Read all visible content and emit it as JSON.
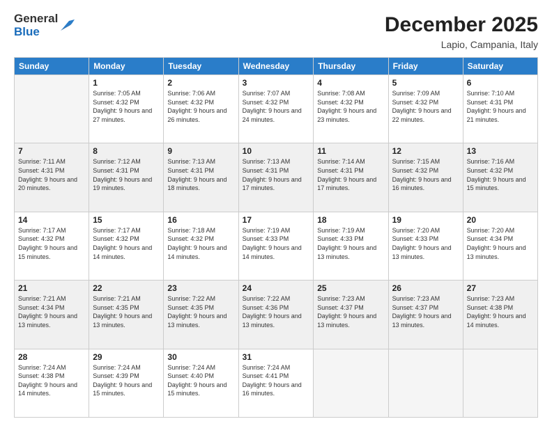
{
  "header": {
    "logo_general": "General",
    "logo_blue": "Blue",
    "month": "December 2025",
    "location": "Lapio, Campania, Italy"
  },
  "days_of_week": [
    "Sunday",
    "Monday",
    "Tuesday",
    "Wednesday",
    "Thursday",
    "Friday",
    "Saturday"
  ],
  "weeks": [
    [
      {
        "day": "",
        "sunrise": "",
        "sunset": "",
        "daylight": ""
      },
      {
        "day": "1",
        "sunrise": "Sunrise: 7:05 AM",
        "sunset": "Sunset: 4:32 PM",
        "daylight": "Daylight: 9 hours and 27 minutes."
      },
      {
        "day": "2",
        "sunrise": "Sunrise: 7:06 AM",
        "sunset": "Sunset: 4:32 PM",
        "daylight": "Daylight: 9 hours and 26 minutes."
      },
      {
        "day": "3",
        "sunrise": "Sunrise: 7:07 AM",
        "sunset": "Sunset: 4:32 PM",
        "daylight": "Daylight: 9 hours and 24 minutes."
      },
      {
        "day": "4",
        "sunrise": "Sunrise: 7:08 AM",
        "sunset": "Sunset: 4:32 PM",
        "daylight": "Daylight: 9 hours and 23 minutes."
      },
      {
        "day": "5",
        "sunrise": "Sunrise: 7:09 AM",
        "sunset": "Sunset: 4:32 PM",
        "daylight": "Daylight: 9 hours and 22 minutes."
      },
      {
        "day": "6",
        "sunrise": "Sunrise: 7:10 AM",
        "sunset": "Sunset: 4:31 PM",
        "daylight": "Daylight: 9 hours and 21 minutes."
      }
    ],
    [
      {
        "day": "7",
        "sunrise": "Sunrise: 7:11 AM",
        "sunset": "Sunset: 4:31 PM",
        "daylight": "Daylight: 9 hours and 20 minutes."
      },
      {
        "day": "8",
        "sunrise": "Sunrise: 7:12 AM",
        "sunset": "Sunset: 4:31 PM",
        "daylight": "Daylight: 9 hours and 19 minutes."
      },
      {
        "day": "9",
        "sunrise": "Sunrise: 7:13 AM",
        "sunset": "Sunset: 4:31 PM",
        "daylight": "Daylight: 9 hours and 18 minutes."
      },
      {
        "day": "10",
        "sunrise": "Sunrise: 7:13 AM",
        "sunset": "Sunset: 4:31 PM",
        "daylight": "Daylight: 9 hours and 17 minutes."
      },
      {
        "day": "11",
        "sunrise": "Sunrise: 7:14 AM",
        "sunset": "Sunset: 4:31 PM",
        "daylight": "Daylight: 9 hours and 17 minutes."
      },
      {
        "day": "12",
        "sunrise": "Sunrise: 7:15 AM",
        "sunset": "Sunset: 4:32 PM",
        "daylight": "Daylight: 9 hours and 16 minutes."
      },
      {
        "day": "13",
        "sunrise": "Sunrise: 7:16 AM",
        "sunset": "Sunset: 4:32 PM",
        "daylight": "Daylight: 9 hours and 15 minutes."
      }
    ],
    [
      {
        "day": "14",
        "sunrise": "Sunrise: 7:17 AM",
        "sunset": "Sunset: 4:32 PM",
        "daylight": "Daylight: 9 hours and 15 minutes."
      },
      {
        "day": "15",
        "sunrise": "Sunrise: 7:17 AM",
        "sunset": "Sunset: 4:32 PM",
        "daylight": "Daylight: 9 hours and 14 minutes."
      },
      {
        "day": "16",
        "sunrise": "Sunrise: 7:18 AM",
        "sunset": "Sunset: 4:32 PM",
        "daylight": "Daylight: 9 hours and 14 minutes."
      },
      {
        "day": "17",
        "sunrise": "Sunrise: 7:19 AM",
        "sunset": "Sunset: 4:33 PM",
        "daylight": "Daylight: 9 hours and 14 minutes."
      },
      {
        "day": "18",
        "sunrise": "Sunrise: 7:19 AM",
        "sunset": "Sunset: 4:33 PM",
        "daylight": "Daylight: 9 hours and 13 minutes."
      },
      {
        "day": "19",
        "sunrise": "Sunrise: 7:20 AM",
        "sunset": "Sunset: 4:33 PM",
        "daylight": "Daylight: 9 hours and 13 minutes."
      },
      {
        "day": "20",
        "sunrise": "Sunrise: 7:20 AM",
        "sunset": "Sunset: 4:34 PM",
        "daylight": "Daylight: 9 hours and 13 minutes."
      }
    ],
    [
      {
        "day": "21",
        "sunrise": "Sunrise: 7:21 AM",
        "sunset": "Sunset: 4:34 PM",
        "daylight": "Daylight: 9 hours and 13 minutes."
      },
      {
        "day": "22",
        "sunrise": "Sunrise: 7:21 AM",
        "sunset": "Sunset: 4:35 PM",
        "daylight": "Daylight: 9 hours and 13 minutes."
      },
      {
        "day": "23",
        "sunrise": "Sunrise: 7:22 AM",
        "sunset": "Sunset: 4:35 PM",
        "daylight": "Daylight: 9 hours and 13 minutes."
      },
      {
        "day": "24",
        "sunrise": "Sunrise: 7:22 AM",
        "sunset": "Sunset: 4:36 PM",
        "daylight": "Daylight: 9 hours and 13 minutes."
      },
      {
        "day": "25",
        "sunrise": "Sunrise: 7:23 AM",
        "sunset": "Sunset: 4:37 PM",
        "daylight": "Daylight: 9 hours and 13 minutes."
      },
      {
        "day": "26",
        "sunrise": "Sunrise: 7:23 AM",
        "sunset": "Sunset: 4:37 PM",
        "daylight": "Daylight: 9 hours and 13 minutes."
      },
      {
        "day": "27",
        "sunrise": "Sunrise: 7:23 AM",
        "sunset": "Sunset: 4:38 PM",
        "daylight": "Daylight: 9 hours and 14 minutes."
      }
    ],
    [
      {
        "day": "28",
        "sunrise": "Sunrise: 7:24 AM",
        "sunset": "Sunset: 4:38 PM",
        "daylight": "Daylight: 9 hours and 14 minutes."
      },
      {
        "day": "29",
        "sunrise": "Sunrise: 7:24 AM",
        "sunset": "Sunset: 4:39 PM",
        "daylight": "Daylight: 9 hours and 15 minutes."
      },
      {
        "day": "30",
        "sunrise": "Sunrise: 7:24 AM",
        "sunset": "Sunset: 4:40 PM",
        "daylight": "Daylight: 9 hours and 15 minutes."
      },
      {
        "day": "31",
        "sunrise": "Sunrise: 7:24 AM",
        "sunset": "Sunset: 4:41 PM",
        "daylight": "Daylight: 9 hours and 16 minutes."
      },
      {
        "day": "",
        "sunrise": "",
        "sunset": "",
        "daylight": ""
      },
      {
        "day": "",
        "sunrise": "",
        "sunset": "",
        "daylight": ""
      },
      {
        "day": "",
        "sunrise": "",
        "sunset": "",
        "daylight": ""
      }
    ]
  ]
}
